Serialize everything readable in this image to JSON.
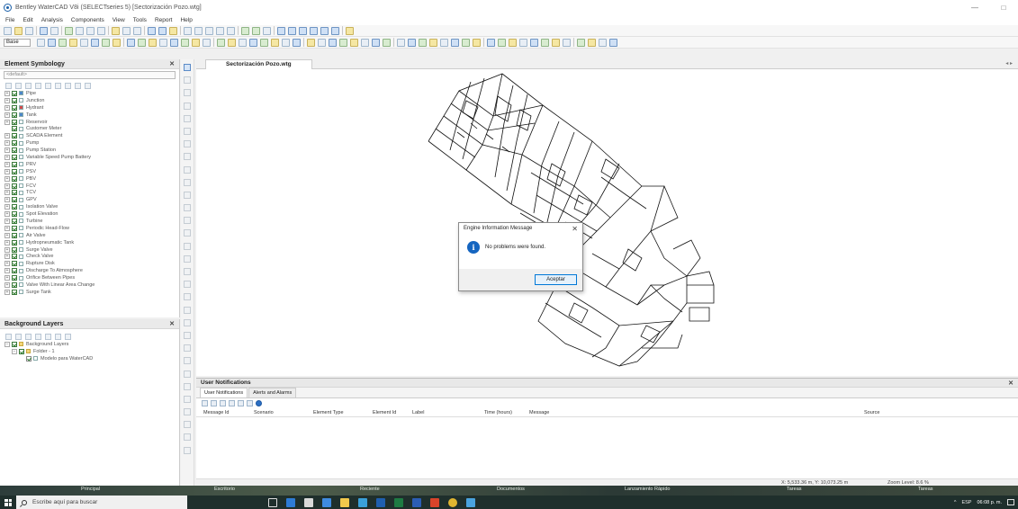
{
  "window": {
    "title": "Bentley WaterCAD V8i (SELECTseries 5) [Sectorización Pozo.wtg]",
    "minimize": "—",
    "maximize": "□"
  },
  "menu": [
    "File",
    "Edit",
    "Analysis",
    "Components",
    "View",
    "Tools",
    "Report",
    "Help"
  ],
  "toolbar": {
    "scenario_select": "Base"
  },
  "symbology": {
    "title": "Element Symbology",
    "pin": " ✕",
    "combo": "<default>",
    "items": [
      {
        "expander": "+",
        "label": "Pipe"
      },
      {
        "expander": "+",
        "label": "Junction"
      },
      {
        "expander": "+",
        "label": "Hydrant"
      },
      {
        "expander": "+",
        "label": "Tank"
      },
      {
        "expander": "+",
        "label": "Reservoir"
      },
      {
        "expander": "",
        "label": "Customer Meter"
      },
      {
        "expander": "+",
        "label": "SCADA Element"
      },
      {
        "expander": "+",
        "label": "Pump"
      },
      {
        "expander": "+",
        "label": "Pump Station"
      },
      {
        "expander": "+",
        "label": "Variable Speed Pump Battery"
      },
      {
        "expander": "+",
        "label": "PRV"
      },
      {
        "expander": "+",
        "label": "PSV"
      },
      {
        "expander": "+",
        "label": "PBV"
      },
      {
        "expander": "+",
        "label": "FCV"
      },
      {
        "expander": "+",
        "label": "TCV"
      },
      {
        "expander": "+",
        "label": "GPV"
      },
      {
        "expander": "+",
        "label": "Isolation Valve"
      },
      {
        "expander": "+",
        "label": "Spot Elevation"
      },
      {
        "expander": "+",
        "label": "Turbine"
      },
      {
        "expander": "+",
        "label": "Periodic Head-Flow"
      },
      {
        "expander": "+",
        "label": "Air Valve"
      },
      {
        "expander": "+",
        "label": "Hydropneumatic Tank"
      },
      {
        "expander": "+",
        "label": "Surge Valve"
      },
      {
        "expander": "+",
        "label": "Check Valve"
      },
      {
        "expander": "+",
        "label": "Rupture Disk"
      },
      {
        "expander": "+",
        "label": "Discharge To Atmosphere"
      },
      {
        "expander": "+",
        "label": "Orifice Between Pipes"
      },
      {
        "expander": "+",
        "label": "Valve With Linear Area Change"
      },
      {
        "expander": "+",
        "label": "Surge Tank"
      }
    ]
  },
  "background": {
    "title": "Background Layers",
    "pin": " ✕",
    "items": [
      {
        "expander": "−",
        "label": "Background Layers"
      },
      {
        "expander": "−",
        "label": "Folder - 1"
      },
      {
        "expander": "",
        "label": "Modelo para WaterCAD"
      }
    ]
  },
  "document": {
    "tab": "Sectorización Pozo.wtg",
    "pin": "◂ ▸"
  },
  "dialog": {
    "title": "Engine Information Message",
    "close": "✕",
    "icon": "i",
    "message": "No problems were found.",
    "ok": "Aceptar"
  },
  "notifications": {
    "title": "User Notifications",
    "pin": " ✕",
    "tabs": [
      "User Notifications",
      "Alerts and Alarms"
    ],
    "columns": [
      "Message Id",
      "Scenario",
      "Element Type",
      "Element Id",
      "Label",
      "Time (hours)",
      "Message",
      "Source"
    ]
  },
  "status": {
    "coords": "X: 5,533.36 m, Y: 10,073.25 m",
    "zoom": "Zoom Level: 8.6 %"
  },
  "taskbar_groups": [
    "Principal",
    "Escritorio",
    "Reciente",
    "Documentos",
    "Lanzamiento Rápido",
    "Tareas",
    "Tareas"
  ],
  "search_placeholder": "Escribe aquí para buscar",
  "tray": {
    "lang": "ESP",
    "time": "06:08 p. m."
  },
  "colors": {
    "accent": "#1565c0",
    "pipe": "#111111",
    "taskbar": "#1f2f2c"
  }
}
